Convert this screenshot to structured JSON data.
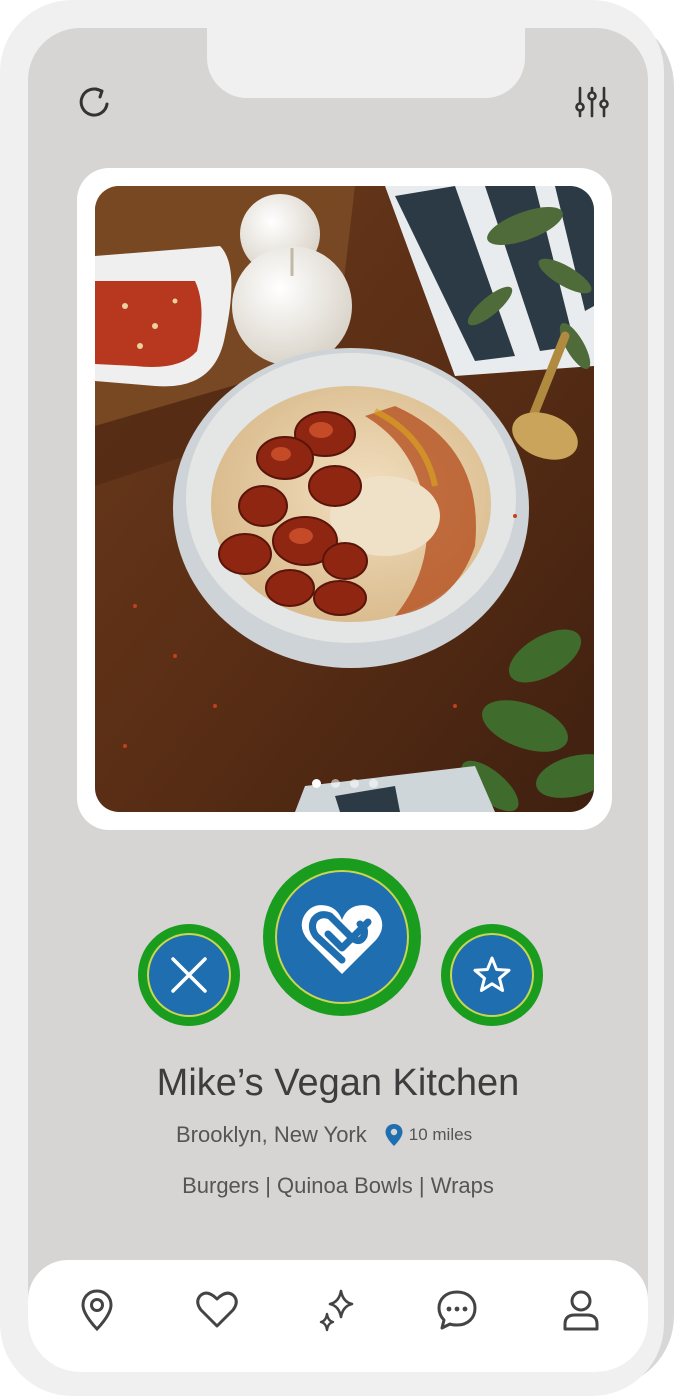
{
  "restaurant": {
    "name": "Mike’s Vegan Kitchen",
    "location": "Brooklyn, New York",
    "distance": "10 miles",
    "tags": "Burgers | Quinoa Bowls | Wraps"
  },
  "carousel": {
    "total": 4,
    "active_index": 0
  },
  "top_bar": {
    "left_icon": "refresh-icon",
    "right_icon": "filter-sliders-icon"
  },
  "actions": {
    "reject_icon": "close-icon",
    "like_icon": "heart-logo-icon",
    "favorite_icon": "star-icon"
  },
  "bottom_nav": [
    "map-pin-icon",
    "heart-icon",
    "sparkle-icon",
    "chat-icon",
    "profile-icon"
  ],
  "colors": {
    "accent_blue": "#1f6fb0",
    "ring_green": "#1a9d1f",
    "screen_bg": "#d6d5d4"
  }
}
